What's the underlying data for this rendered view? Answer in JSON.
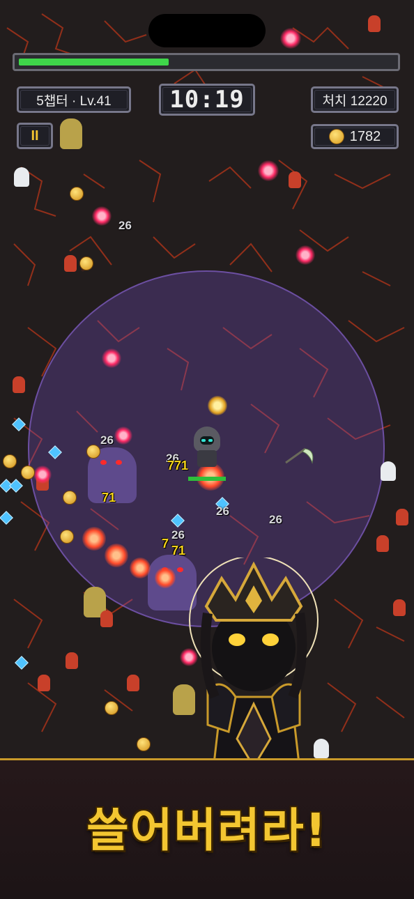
{
  "hud": {
    "chapter_level": "5챕터 · Lv.41",
    "timer": "10:19",
    "kills": "처치 12220",
    "coins": "1782",
    "pause_label": "II",
    "xp_progress_percent": 40
  },
  "combat_text": {
    "dmg_26": "26",
    "dmg_71": "71",
    "dmg_771": "771",
    "dmg_7": "7"
  },
  "banner": {
    "slogan": "쓸어버려라!"
  },
  "colors": {
    "xp_green": "#3fd64a",
    "gold": "#f3c631",
    "aura": "#7850c8"
  }
}
